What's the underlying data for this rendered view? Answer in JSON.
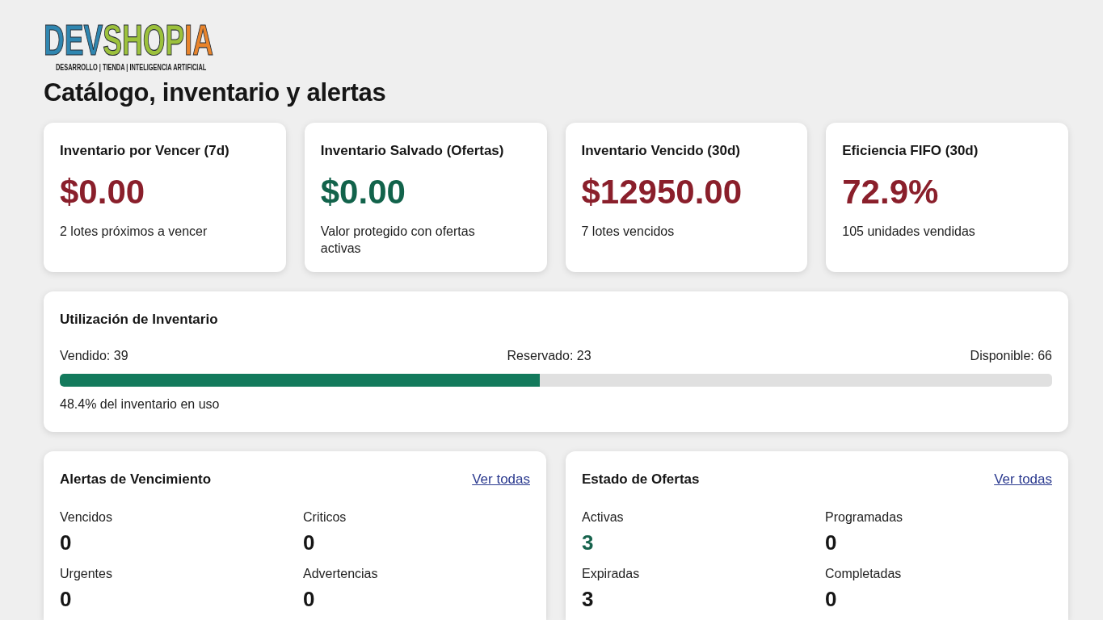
{
  "logo": {
    "segments": [
      {
        "text": "DEV",
        "color": "#2f86b0"
      },
      {
        "text": "SHOP",
        "color": "#9cc13c"
      },
      {
        "text": "IA",
        "color": "#e8842c"
      }
    ],
    "tagline": "DESARROLLO | TIENDA | INTELIGENCIA ARTIFICIAL"
  },
  "page_title": "Catálogo, inventario y alertas",
  "kpi_cards": [
    {
      "title": "Inventario por Vencer (7d)",
      "value": "$0.00",
      "color": "#8a1f2b",
      "caption": "2 lotes próximos a vencer"
    },
    {
      "title": "Inventario Salvado (Ofertas)",
      "value": "$0.00",
      "color": "#12634b",
      "caption": "Valor protegido con ofertas activas"
    },
    {
      "title": "Inventario Vencido (30d)",
      "value": "$12950.00",
      "color": "#8a1f2b",
      "caption": "7 lotes vencidos"
    },
    {
      "title": "Eficiencia FIFO (30d)",
      "value": "72.9%",
      "color": "#8a1f2b",
      "caption": "105 unidades vendidas"
    }
  ],
  "utilization": {
    "title": "Utilización de Inventario",
    "labels": [
      "Vendido: 39",
      "Reservado: 23",
      "Disponible: 66"
    ],
    "level": 0.484,
    "caption": "48.4% del inventario en uso"
  },
  "panels": [
    {
      "title": "Alertas de Vencimiento",
      "link": "Ver todas",
      "stats": [
        {
          "label": "Vencidos",
          "value": "0",
          "color": "#161616"
        },
        {
          "label": "Criticos",
          "value": "0",
          "color": "#161616"
        },
        {
          "label": "Urgentes",
          "value": "0",
          "color": "#161616"
        },
        {
          "label": "Advertencias",
          "value": "0",
          "color": "#161616"
        }
      ]
    },
    {
      "title": "Estado de Ofertas",
      "link": "Ver todas",
      "stats": [
        {
          "label": "Activas",
          "value": "3",
          "color": "#17634d"
        },
        {
          "label": "Programadas",
          "value": "0",
          "color": "#161616"
        },
        {
          "label": "Expiradas",
          "value": "3",
          "color": "#161616"
        },
        {
          "label": "Completadas",
          "value": "0",
          "color": "#161616"
        }
      ]
    }
  ]
}
